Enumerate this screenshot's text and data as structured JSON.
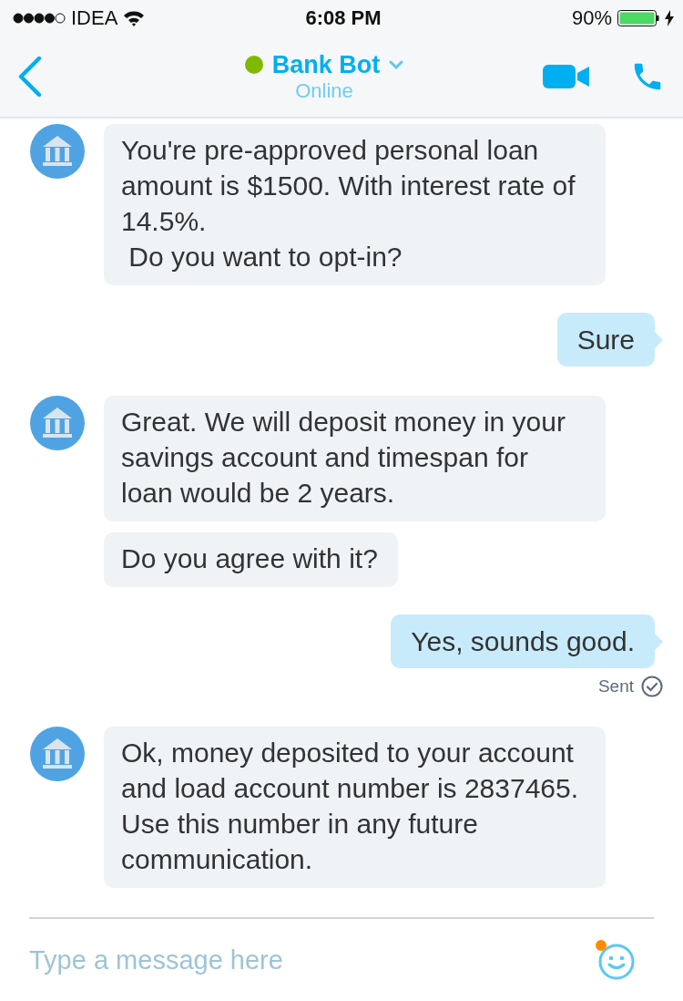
{
  "status_bar": {
    "carrier": "IDEA",
    "time": "6:08 PM",
    "battery": "90%"
  },
  "header": {
    "name": "Bank Bot",
    "online": true,
    "status": "Online"
  },
  "messages": [
    {
      "kind": "bot",
      "bubbles": [
        "You're pre-approved personal loan amount is $1500. With interest rate of 14.5%.\n Do you want to opt-in?"
      ]
    },
    {
      "kind": "user",
      "bubbles": [
        "Sure"
      ]
    },
    {
      "kind": "bot",
      "bubbles": [
        "Great. We will deposit money in your savings account and timespan for loan would be 2 years.",
        "Do you agree with it?"
      ]
    },
    {
      "kind": "user",
      "bubbles": [
        "Yes, sounds good."
      ],
      "status": "Sent"
    },
    {
      "kind": "bot",
      "bubbles": [
        "Ok, money deposited to your account and load account number is 2837465. Use this number in any future communication."
      ]
    }
  ],
  "composer": {
    "placeholder": "Type a message here",
    "notification": true
  }
}
